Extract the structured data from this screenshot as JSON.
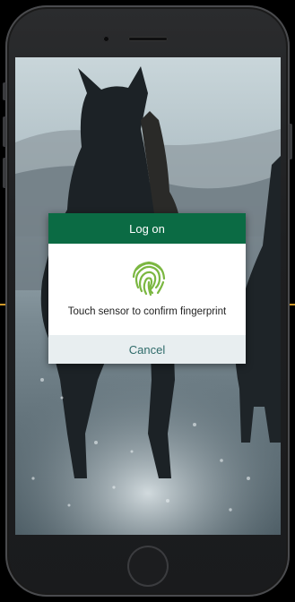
{
  "dialog": {
    "title": "Log on",
    "message": "Touch sensor to confirm fingerprint",
    "cancel_label": "Cancel",
    "icon": "fingerprint-icon"
  },
  "colors": {
    "header_green": "#0b6b44",
    "fingerprint_green": "#7bb741",
    "cancel_text": "#2f6b6a",
    "cancel_bg": "#e8eef0"
  }
}
